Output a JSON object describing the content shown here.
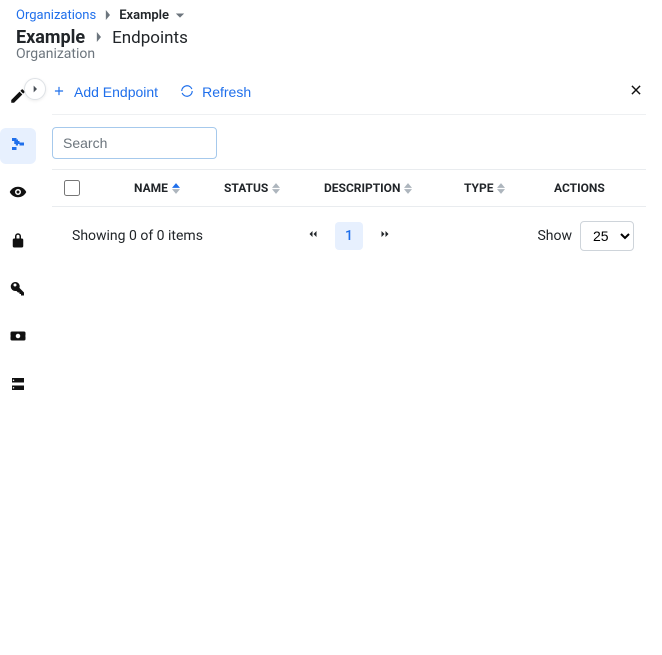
{
  "breadcrumb": {
    "root": "Organizations",
    "current": "Example"
  },
  "header": {
    "title": "Example",
    "section": "Endpoints",
    "subtitle": "Organization"
  },
  "toolbar": {
    "add_endpoint": "Add Endpoint",
    "refresh": "Refresh"
  },
  "search": {
    "placeholder": "Search",
    "value": ""
  },
  "table": {
    "columns": {
      "name": "NAME",
      "status": "STATUS",
      "description": "DESCRIPTION",
      "type": "TYPE",
      "actions": "ACTIONS"
    }
  },
  "pagination": {
    "showing": "Showing 0 of 0 items",
    "current_page": "1",
    "show_label": "Show",
    "page_size": "25"
  },
  "sidebar": {
    "items": [
      {
        "name": "edit",
        "active": false
      },
      {
        "name": "hierarchy",
        "active": true
      },
      {
        "name": "visibility",
        "active": false
      },
      {
        "name": "lock",
        "active": false
      },
      {
        "name": "key",
        "active": false
      },
      {
        "name": "ticket",
        "active": false
      },
      {
        "name": "server",
        "active": false
      }
    ]
  }
}
